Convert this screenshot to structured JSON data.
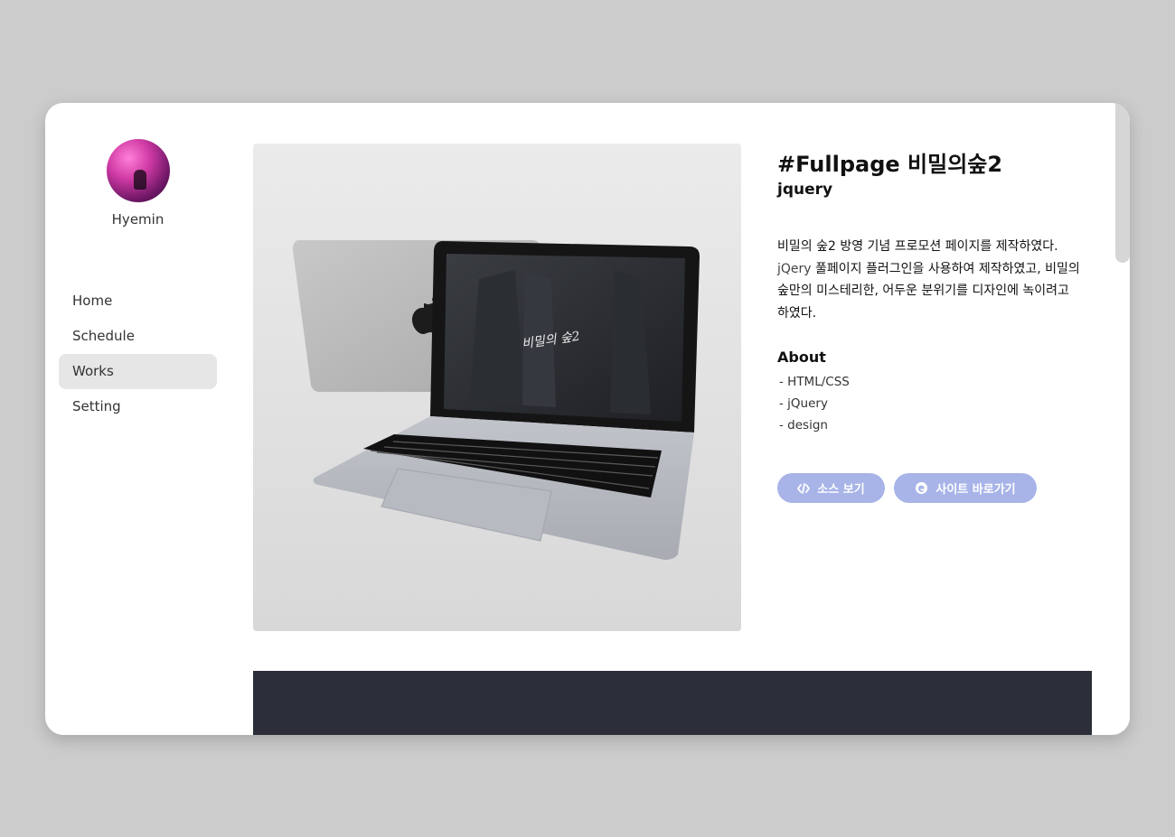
{
  "user": {
    "name": "Hyemin"
  },
  "nav": {
    "items": [
      {
        "label": "Home"
      },
      {
        "label": "Schedule"
      },
      {
        "label": "Works"
      },
      {
        "label": "Setting"
      }
    ],
    "active_index": 2
  },
  "project": {
    "title": "#Fullpage 비밀의숲2",
    "tech": "jquery",
    "description_part1": "비밀의 숲2 방영 기념 프로모션 페이지를 제작하였다. ",
    "description_highlight": "jQery",
    "description_part2": " 풀페이지 플러그인을 사용하여 제작하였고, 비밀의 숲만의 미스테리한, 어두운 분위기를 디자인에 녹이려고 하였다.",
    "laptop_screen_text": "비밀의 숲2",
    "about": {
      "heading": "About",
      "items": [
        " - HTML/CSS",
        " - jQuery",
        " - design"
      ]
    }
  },
  "buttons": {
    "source_label": "소스 보기",
    "site_label": "사이트 바로가기"
  },
  "colors": {
    "button_bg": "#a8b4e8",
    "dark_band": "#2c2f39",
    "background": "#cccccc",
    "nav_active": "#e6e6e6"
  },
  "icons": {
    "source": "code-icon",
    "site": "edge-browser-icon"
  }
}
